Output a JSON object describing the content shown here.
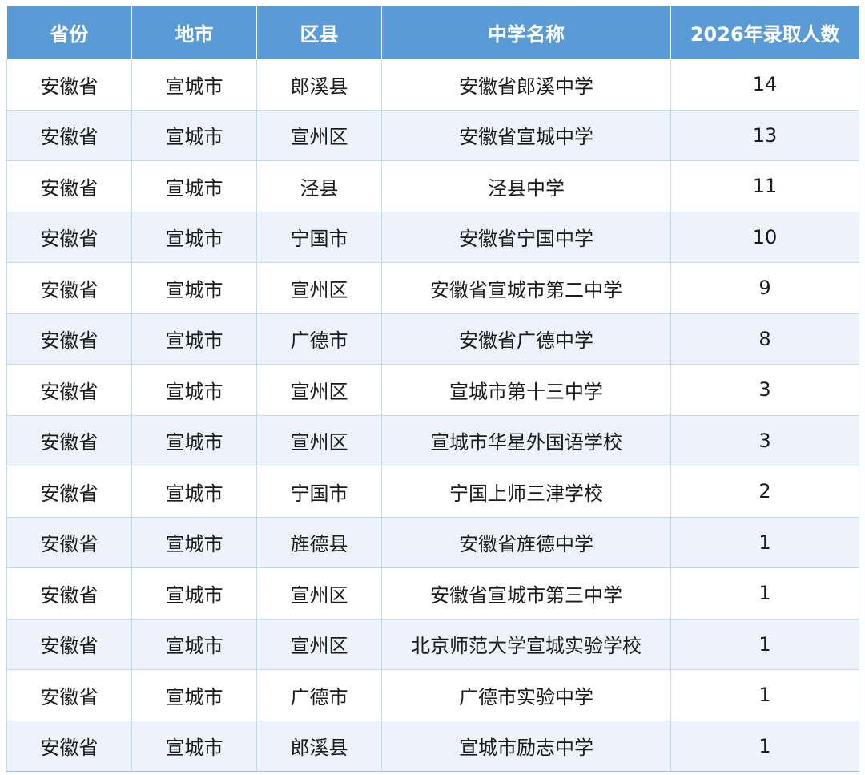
{
  "table": {
    "headers": [
      "省份",
      "地市",
      "区县",
      "中学名称",
      "2026年录取人数"
    ],
    "rows": [
      [
        "安徽省",
        "宣城市",
        "郎溪县",
        "安徽省郎溪中学",
        "14"
      ],
      [
        "安徽省",
        "宣城市",
        "宣州区",
        "安徽省宣城中学",
        "13"
      ],
      [
        "安徽省",
        "宣城市",
        "泾县",
        "泾县中学",
        "11"
      ],
      [
        "安徽省",
        "宣城市",
        "宁国市",
        "安徽省宁国中学",
        "10"
      ],
      [
        "安徽省",
        "宣城市",
        "宣州区",
        "安徽省宣城市第二中学",
        "9"
      ],
      [
        "安徽省",
        "宣城市",
        "广德市",
        "安徽省广德中学",
        "8"
      ],
      [
        "安徽省",
        "宣城市",
        "宣州区",
        "宣城市第十三中学",
        "3"
      ],
      [
        "安徽省",
        "宣城市",
        "宣州区",
        "宣城市华星外国语学校",
        "3"
      ],
      [
        "安徽省",
        "宣城市",
        "宁国市",
        "宁国上师三津学校",
        "2"
      ],
      [
        "安徽省",
        "宣城市",
        "旌德县",
        "安徽省旌德中学",
        "1"
      ],
      [
        "安徽省",
        "宣城市",
        "宣州区",
        "安徽省宣城市第三中学",
        "1"
      ],
      [
        "安徽省",
        "宣城市",
        "宣州区",
        "北京师范大学宣城实验学校",
        "1"
      ],
      [
        "安徽省",
        "宣城市",
        "广德市",
        "广德市实验中学",
        "1"
      ],
      [
        "安徽省",
        "宣城市",
        "郎溪县",
        "宣城市励志中学",
        "1"
      ]
    ]
  },
  "colors": {
    "header_bg": "#5b9bd5",
    "header_text": "#ffffff",
    "row_alt_bg": "#edf3fa",
    "border": "#c5d9ee"
  }
}
